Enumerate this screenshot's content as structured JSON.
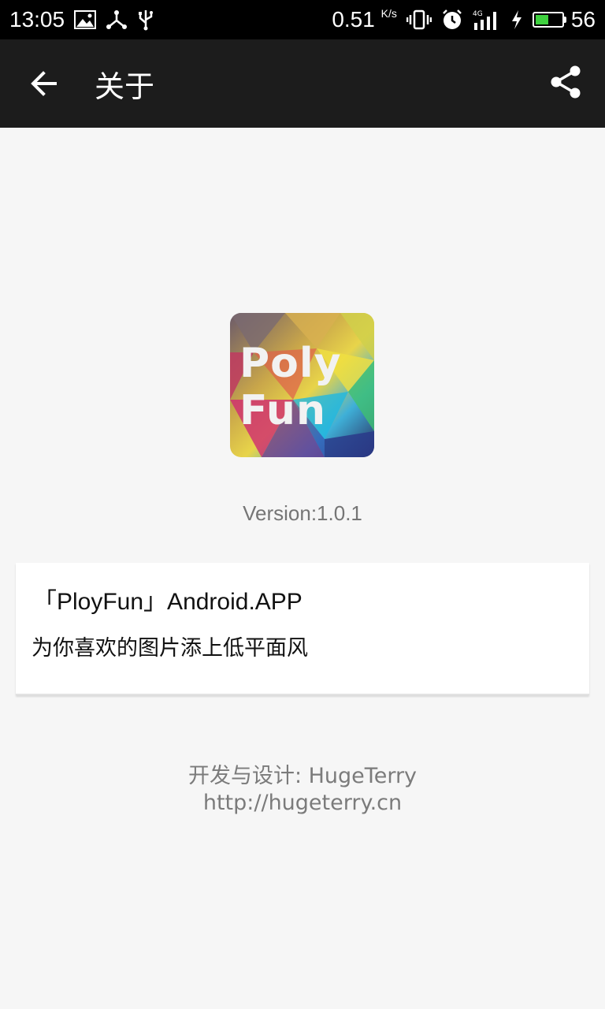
{
  "status_bar": {
    "time": "13:05",
    "net_speed": "0.51",
    "net_unit": "K/s",
    "network": "4G",
    "battery_level": "56"
  },
  "app_bar": {
    "title": "关于",
    "back_icon": "arrow-back-icon",
    "share_icon": "share-icon"
  },
  "logo": {
    "line1": "Poly",
    "line2": "Fun"
  },
  "version": "Version:1.0.1",
  "card": {
    "title": "「PloyFun」Android.APP",
    "description": "为你喜欢的图片添上低平面风"
  },
  "footer": {
    "developer": "开发与设计: HugeTerry",
    "website": "http://hugeterry.cn"
  },
  "colors": {
    "status_bar_bg": "#000000",
    "app_bar_bg": "#1c1c1c",
    "page_bg": "#f6f6f6",
    "battery_green": "#3fd13f"
  }
}
